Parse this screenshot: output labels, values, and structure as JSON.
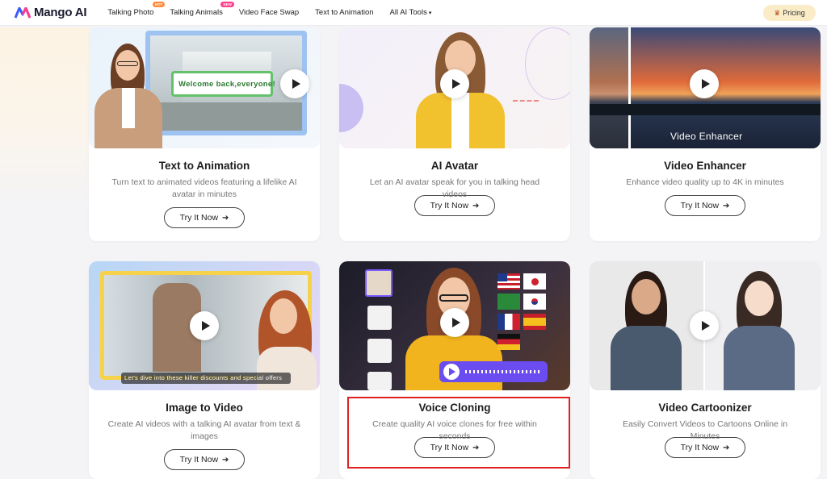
{
  "nav": {
    "logo": "Mango AI",
    "items": [
      {
        "label": "Talking Photo",
        "badge": "HOT"
      },
      {
        "label": "Talking Animals",
        "badge": "NEW"
      },
      {
        "label": "Video Face Swap"
      },
      {
        "label": "Text to Animation"
      },
      {
        "label": "All AI Tools"
      }
    ],
    "pricing": "Pricing"
  },
  "cards": [
    {
      "title": "Text to Animation",
      "desc": "Turn text to animated videos featuring a lifelike AI avatar in minutes",
      "button": "Try It Now",
      "overlay": "Welcome back,everyone!"
    },
    {
      "title": "AI Avatar",
      "desc": "Let an AI avatar speak for you in talking head videos",
      "button": "Try It Now"
    },
    {
      "title": "Video Enhancer",
      "desc": "Enhance video quality up to 4K in minutes",
      "button": "Try It Now",
      "overlay": "Video Enhancer"
    },
    {
      "title": "Image to Video",
      "desc": "Create AI videos with a talking AI avatar from text & images",
      "button": "Try It Now",
      "overlay": "Let's dive into these killer discounts and special offers"
    },
    {
      "title": "Voice Cloning",
      "desc": "Create quality AI voice clones for free within seconds",
      "button": "Try It Now"
    },
    {
      "title": "Video Cartoonizer",
      "desc": "Easily Convert Videos to Cartoons Online in Minutes",
      "button": "Try It Now"
    }
  ],
  "colors": {
    "accent": "#1a1a2e",
    "highlight": "#e02020",
    "pricing_bg": "#fbecc8"
  }
}
